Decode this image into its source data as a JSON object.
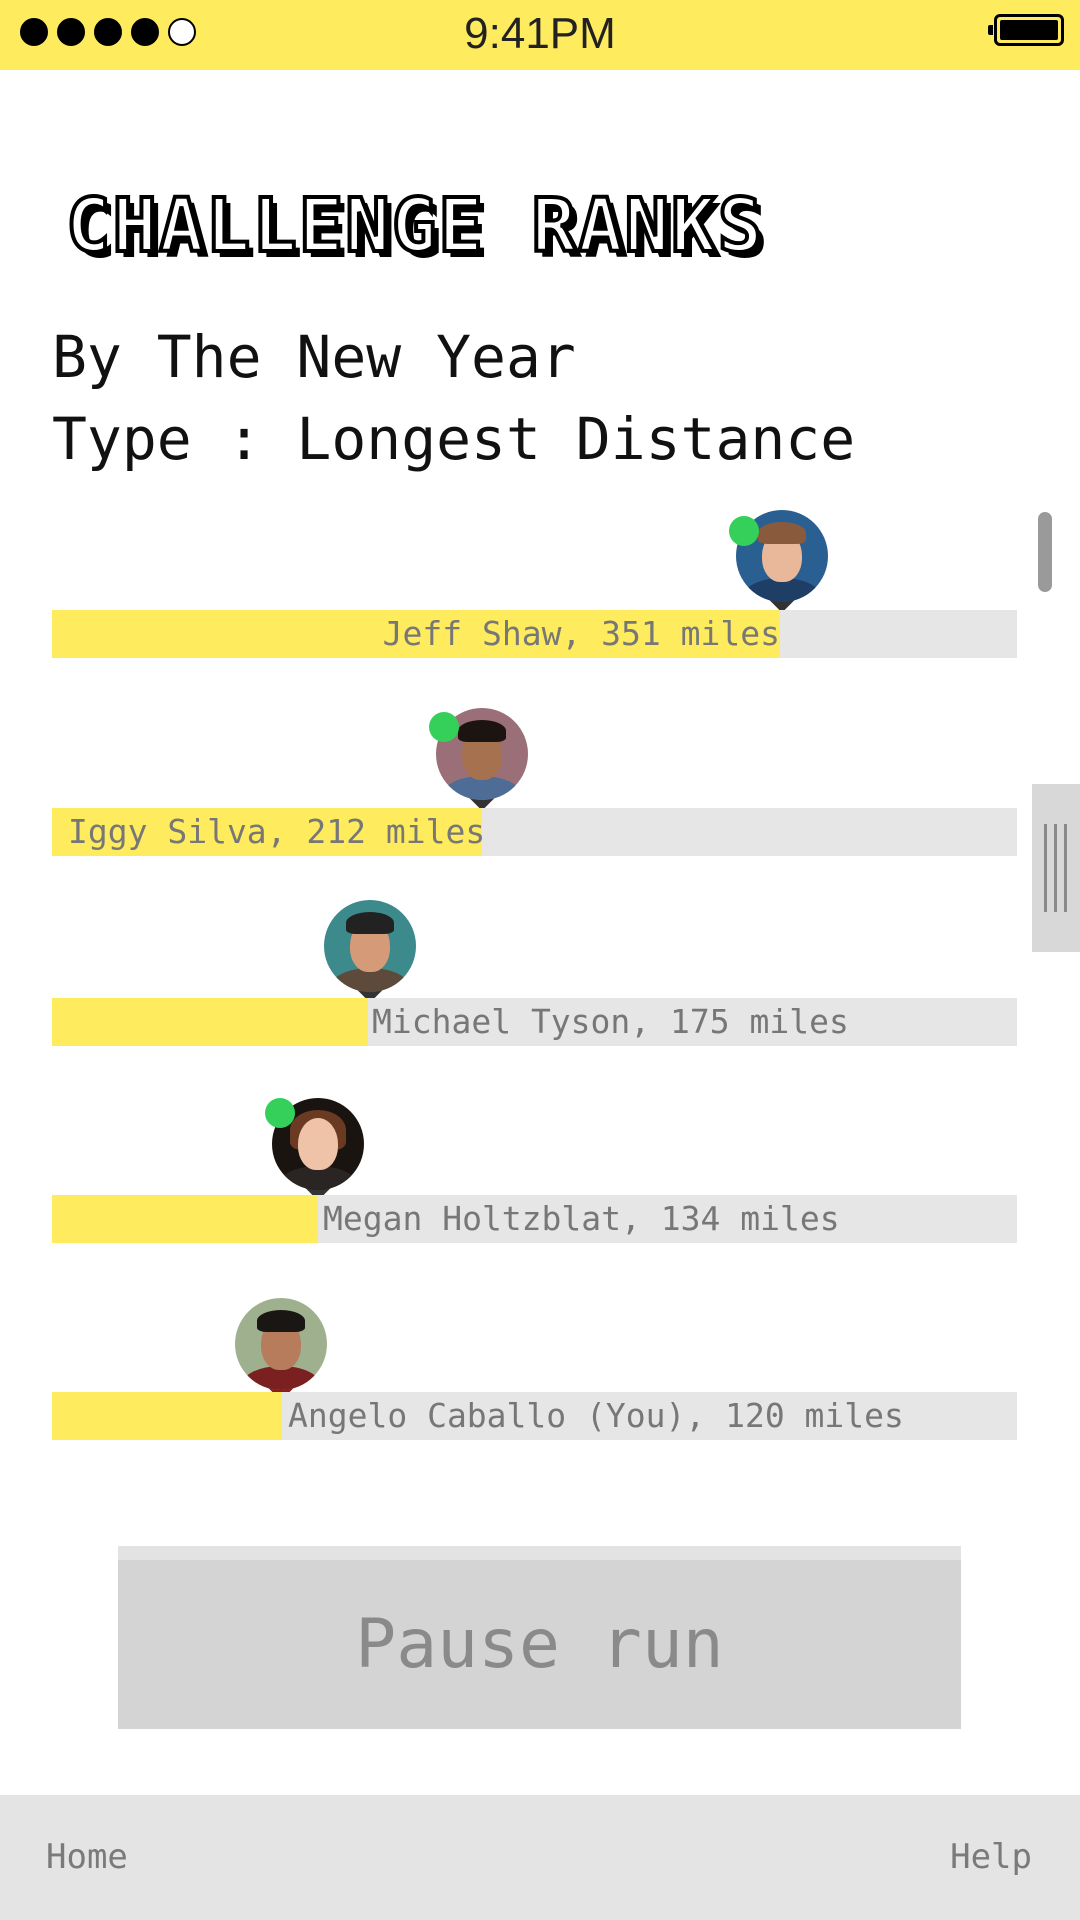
{
  "status_bar": {
    "time": "9:41PM",
    "signal_bars_filled": 4,
    "signal_bars_total": 5
  },
  "header": {
    "title": "CHALLENGE RANKS",
    "challenge_name": "By The New Year",
    "challenge_type": "Type : Longest Distance"
  },
  "ranks": [
    {
      "label": "Jeff Shaw, 351 miles",
      "miles": 351,
      "online": true,
      "you": false
    },
    {
      "label": "Iggy Silva, 212 miles",
      "miles": 212,
      "online": true,
      "you": false
    },
    {
      "label": "Michael Tyson, 175 miles",
      "miles": 175,
      "online": false,
      "you": false
    },
    {
      "label": "Megan Holtzblat, 134 miles",
      "miles": 134,
      "online": true,
      "you": false
    },
    {
      "label": "Angelo Caballo (You), 120 miles",
      "miles": 120,
      "online": false,
      "you": true
    }
  ],
  "actions": {
    "pause_label": "Pause run"
  },
  "nav": {
    "home_label": "Home",
    "help_label": "Help"
  },
  "colors": {
    "accent": "#ffeb5e",
    "track": "#e6e6e6",
    "online": "#34d05a",
    "muted_text": "#777777"
  }
}
